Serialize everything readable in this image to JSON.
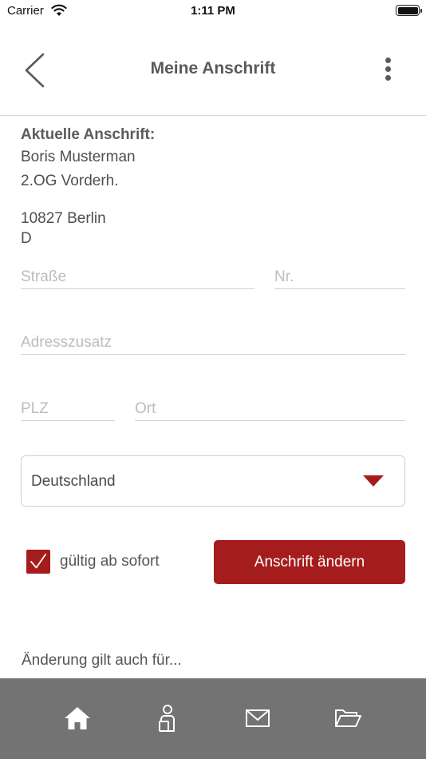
{
  "status": {
    "carrier": "Carrier",
    "time": "1:11 PM"
  },
  "nav": {
    "title": "Meine Anschrift"
  },
  "current_address": {
    "heading": "Aktuelle Anschrift:",
    "name": "Boris Musterman",
    "extra": "2.OG Vorderh.",
    "city": "10827 Berlin",
    "country_code": "D"
  },
  "form": {
    "street_placeholder": "Straße",
    "number_placeholder": "Nr.",
    "addition_placeholder": "Adresszusatz",
    "zip_placeholder": "PLZ",
    "city_placeholder": "Ort",
    "country_selected": "Deutschland",
    "valid_checked": true,
    "valid_label": "gültig ab sofort",
    "submit_label": "Anschrift ändern"
  },
  "also_applies_label": "Änderung gilt auch für...",
  "tabs": [
    "home-icon",
    "profile-icon",
    "mail-icon",
    "folder-icon"
  ],
  "colors": {
    "accent": "#a51c1c",
    "tabbar": "#737373"
  }
}
